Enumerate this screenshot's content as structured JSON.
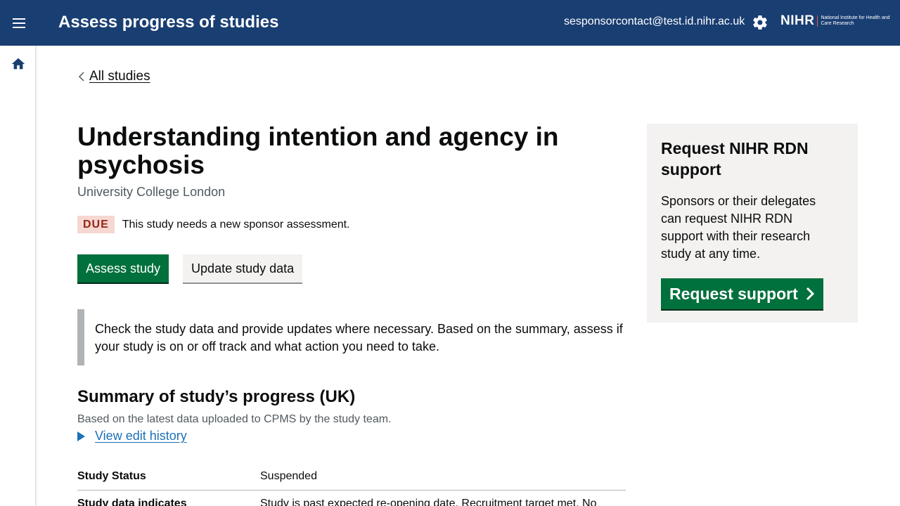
{
  "header": {
    "title": "Assess progress of studies",
    "user_email": "sesponsorcontact@test.id.nihr.ac.uk",
    "logo_main": "NIHR",
    "logo_sub": "National Institute for Health and Care Research",
    "icons": {
      "menu": "menu-icon",
      "settings": "gear-icon"
    }
  },
  "sidebar": {
    "home_icon": "home-icon"
  },
  "back_link": {
    "label": "All studies"
  },
  "study": {
    "title": "Understanding intention and agency in psychosis",
    "organisation": "University College London",
    "due_tag": "DUE",
    "due_text": "This study needs a new sponsor assessment."
  },
  "actions": {
    "assess_label": "Assess study",
    "update_label": "Update study data"
  },
  "inset_text": "Check the study data and provide updates where necessary. Based on the summary, assess if your study is on or off track and what action you need to take.",
  "summary": {
    "title": "Summary of study’s progress (UK)",
    "subtitle": "Based on the latest data uploaded to CPMS by the study team.",
    "history_label": "View edit history",
    "rows": [
      {
        "key": "Study Status",
        "value": "Suspended"
      },
      {
        "key": "Study data indicates",
        "value": "Study is past expected re-opening date. Recruitment target met. No"
      }
    ]
  },
  "support_panel": {
    "title": "Request NIHR RDN support",
    "body": "Sponsors or their delegates can request NIHR RDN support with their research study at any time.",
    "button_label": "Request support"
  },
  "colors": {
    "header_bg": "#193e72",
    "primary_green": "#00703c",
    "due_bg": "#f6d7d2",
    "due_text": "#942514",
    "link_blue": "#1d70b8",
    "panel_bg": "#f3f2f1"
  }
}
